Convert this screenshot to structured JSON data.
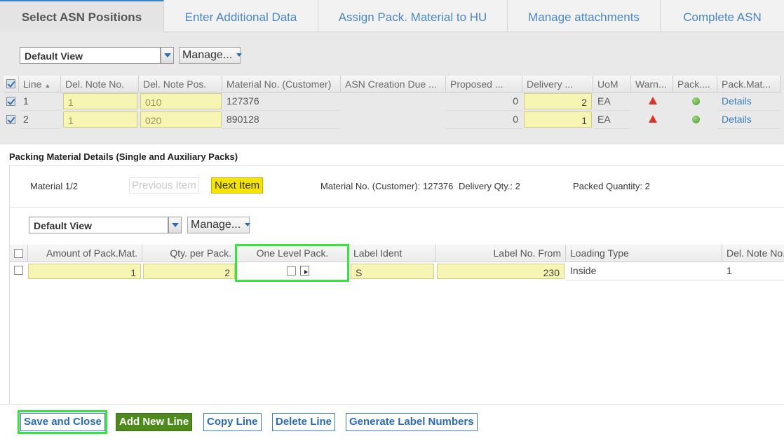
{
  "tabs": [
    "Select ASN Positions",
    "Enter Additional Data",
    "Assign Pack. Material to HU",
    "Manage attachments",
    "Complete ASN"
  ],
  "upper": {
    "view_select": "Default View",
    "manage_label": "Manage...",
    "columns": [
      "Line",
      "Del. Note No.",
      "Del. Note Pos.",
      "Material No. (Customer)",
      "ASN Creation Due ...",
      "Proposed ...",
      "Delivery ...",
      "UoM",
      "Warn...",
      "Pack....",
      "Pack.Mat..."
    ],
    "rows": [
      {
        "line": "1",
        "del_note_no": "1",
        "del_note_pos": "010",
        "material": "127376",
        "proposed": "0",
        "delivery": "2",
        "uom": "EA",
        "pack_mat": "Details"
      },
      {
        "line": "2",
        "del_note_no": "1",
        "del_note_pos": "020",
        "material": "890128",
        "proposed": "0",
        "delivery": "1",
        "uom": "EA",
        "pack_mat": "Details"
      }
    ]
  },
  "panel": {
    "title": "Packing Material Details (Single and Auxiliary Packs)",
    "material_counter": "Material 1/2",
    "prev_label": "Previous Item",
    "next_label": "Next Item",
    "material_info": "Material No. (Customer): 127376",
    "delivery_qty": "Delivery Qty.: 2",
    "packed_qty": "Packed Quantity: 2",
    "view_select": "Default View",
    "manage_label": "Manage...",
    "columns": [
      "Amount of Pack.Mat.",
      "Qty. per Pack.",
      "One Level Pack.",
      "Label Ident",
      "Label No. From",
      "Loading Type",
      "Del. Note No."
    ],
    "row": {
      "amount": "1",
      "qty": "2",
      "label_ident": "S",
      "label_from": "230",
      "loading": "Inside",
      "del_note": "1"
    }
  },
  "footer": {
    "save_close": "Save and Close",
    "add_line": "Add New Line",
    "copy_line": "Copy Line",
    "delete_line": "Delete Line",
    "gen_labels": "Generate Label Numbers"
  }
}
